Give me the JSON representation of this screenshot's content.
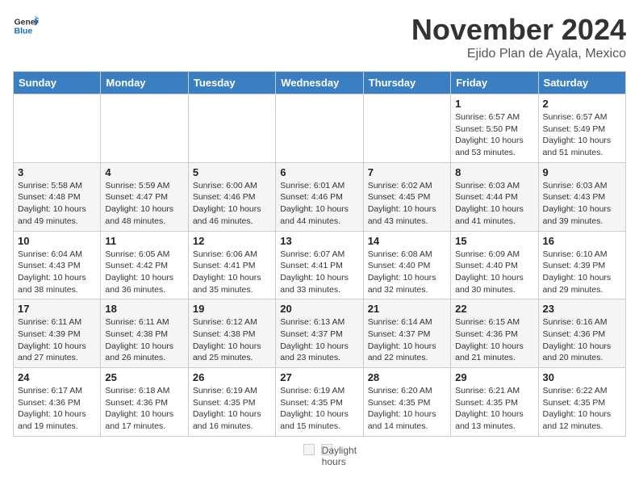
{
  "header": {
    "logo_general": "General",
    "logo_blue": "Blue",
    "month": "November 2024",
    "location": "Ejido Plan de Ayala, Mexico"
  },
  "days_of_week": [
    "Sunday",
    "Monday",
    "Tuesday",
    "Wednesday",
    "Thursday",
    "Friday",
    "Saturday"
  ],
  "weeks": [
    [
      {
        "day": "",
        "info": ""
      },
      {
        "day": "",
        "info": ""
      },
      {
        "day": "",
        "info": ""
      },
      {
        "day": "",
        "info": ""
      },
      {
        "day": "",
        "info": ""
      },
      {
        "day": "1",
        "info": "Sunrise: 6:57 AM\nSunset: 5:50 PM\nDaylight: 10 hours and 53 minutes."
      },
      {
        "day": "2",
        "info": "Sunrise: 6:57 AM\nSunset: 5:49 PM\nDaylight: 10 hours and 51 minutes."
      }
    ],
    [
      {
        "day": "3",
        "info": "Sunrise: 5:58 AM\nSunset: 4:48 PM\nDaylight: 10 hours and 49 minutes."
      },
      {
        "day": "4",
        "info": "Sunrise: 5:59 AM\nSunset: 4:47 PM\nDaylight: 10 hours and 48 minutes."
      },
      {
        "day": "5",
        "info": "Sunrise: 6:00 AM\nSunset: 4:46 PM\nDaylight: 10 hours and 46 minutes."
      },
      {
        "day": "6",
        "info": "Sunrise: 6:01 AM\nSunset: 4:46 PM\nDaylight: 10 hours and 44 minutes."
      },
      {
        "day": "7",
        "info": "Sunrise: 6:02 AM\nSunset: 4:45 PM\nDaylight: 10 hours and 43 minutes."
      },
      {
        "day": "8",
        "info": "Sunrise: 6:03 AM\nSunset: 4:44 PM\nDaylight: 10 hours and 41 minutes."
      },
      {
        "day": "9",
        "info": "Sunrise: 6:03 AM\nSunset: 4:43 PM\nDaylight: 10 hours and 39 minutes."
      }
    ],
    [
      {
        "day": "10",
        "info": "Sunrise: 6:04 AM\nSunset: 4:43 PM\nDaylight: 10 hours and 38 minutes."
      },
      {
        "day": "11",
        "info": "Sunrise: 6:05 AM\nSunset: 4:42 PM\nDaylight: 10 hours and 36 minutes."
      },
      {
        "day": "12",
        "info": "Sunrise: 6:06 AM\nSunset: 4:41 PM\nDaylight: 10 hours and 35 minutes."
      },
      {
        "day": "13",
        "info": "Sunrise: 6:07 AM\nSunset: 4:41 PM\nDaylight: 10 hours and 33 minutes."
      },
      {
        "day": "14",
        "info": "Sunrise: 6:08 AM\nSunset: 4:40 PM\nDaylight: 10 hours and 32 minutes."
      },
      {
        "day": "15",
        "info": "Sunrise: 6:09 AM\nSunset: 4:40 PM\nDaylight: 10 hours and 30 minutes."
      },
      {
        "day": "16",
        "info": "Sunrise: 6:10 AM\nSunset: 4:39 PM\nDaylight: 10 hours and 29 minutes."
      }
    ],
    [
      {
        "day": "17",
        "info": "Sunrise: 6:11 AM\nSunset: 4:39 PM\nDaylight: 10 hours and 27 minutes."
      },
      {
        "day": "18",
        "info": "Sunrise: 6:11 AM\nSunset: 4:38 PM\nDaylight: 10 hours and 26 minutes."
      },
      {
        "day": "19",
        "info": "Sunrise: 6:12 AM\nSunset: 4:38 PM\nDaylight: 10 hours and 25 minutes."
      },
      {
        "day": "20",
        "info": "Sunrise: 6:13 AM\nSunset: 4:37 PM\nDaylight: 10 hours and 23 minutes."
      },
      {
        "day": "21",
        "info": "Sunrise: 6:14 AM\nSunset: 4:37 PM\nDaylight: 10 hours and 22 minutes."
      },
      {
        "day": "22",
        "info": "Sunrise: 6:15 AM\nSunset: 4:36 PM\nDaylight: 10 hours and 21 minutes."
      },
      {
        "day": "23",
        "info": "Sunrise: 6:16 AM\nSunset: 4:36 PM\nDaylight: 10 hours and 20 minutes."
      }
    ],
    [
      {
        "day": "24",
        "info": "Sunrise: 6:17 AM\nSunset: 4:36 PM\nDaylight: 10 hours and 19 minutes."
      },
      {
        "day": "25",
        "info": "Sunrise: 6:18 AM\nSunset: 4:36 PM\nDaylight: 10 hours and 17 minutes."
      },
      {
        "day": "26",
        "info": "Sunrise: 6:19 AM\nSunset: 4:35 PM\nDaylight: 10 hours and 16 minutes."
      },
      {
        "day": "27",
        "info": "Sunrise: 6:19 AM\nSunset: 4:35 PM\nDaylight: 10 hours and 15 minutes."
      },
      {
        "day": "28",
        "info": "Sunrise: 6:20 AM\nSunset: 4:35 PM\nDaylight: 10 hours and 14 minutes."
      },
      {
        "day": "29",
        "info": "Sunrise: 6:21 AM\nSunset: 4:35 PM\nDaylight: 10 hours and 13 minutes."
      },
      {
        "day": "30",
        "info": "Sunrise: 6:22 AM\nSunset: 4:35 PM\nDaylight: 10 hours and 12 minutes."
      }
    ]
  ],
  "footer": {
    "note_label": "Daylight hours"
  }
}
